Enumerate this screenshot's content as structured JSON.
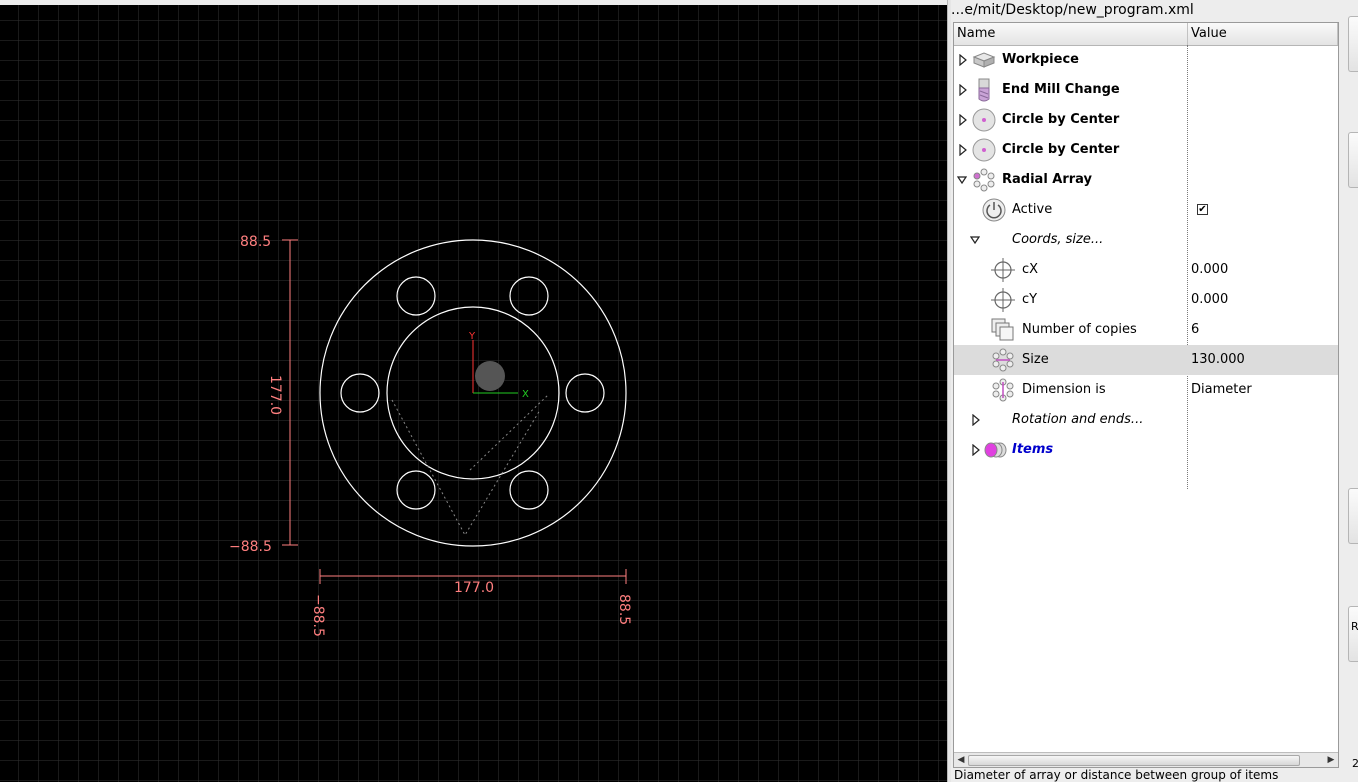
{
  "window": {
    "file_path": "...e/mit/Desktop/new_program.xml"
  },
  "tree": {
    "columns": {
      "name": "Name",
      "value": "Value"
    },
    "rows": [
      {
        "label": "Workpiece",
        "value": ""
      },
      {
        "label": "End Mill Change",
        "value": ""
      },
      {
        "label": "Circle by Center",
        "value": ""
      },
      {
        "label": "Circle by Center",
        "value": ""
      },
      {
        "label": "Radial Array",
        "value": ""
      },
      {
        "label": "Active",
        "value": ""
      },
      {
        "label": "Coords, size...",
        "value": ""
      },
      {
        "label": "cX",
        "value": "0.000"
      },
      {
        "label": "cY",
        "value": "0.000"
      },
      {
        "label": "Number of copies",
        "value": "6"
      },
      {
        "label": "Size",
        "value": "130.000"
      },
      {
        "label": "Dimension is",
        "value": "Diameter"
      },
      {
        "label": "Rotation and ends...",
        "value": ""
      },
      {
        "label": "Items",
        "value": ""
      }
    ],
    "active_checked": true,
    "checkbox_mark": "✔"
  },
  "canvas": {
    "axis_x_label": "X",
    "axis_y_label": "Y",
    "dim_vertical_top": "88.5",
    "dim_vertical_bottom": "−88.5",
    "dim_vertical_length": "177.0",
    "dim_horizontal_left": "−88.5",
    "dim_horizontal_right": "88.5",
    "dim_horizontal_length": "177.0",
    "colors": {
      "background": "#000000",
      "grid": "#333333",
      "geometry": "#ffffff",
      "dimension": "#ff7f7f",
      "axis_x": "#22cc22",
      "axis_y": "#ff3333"
    }
  },
  "edge": {
    "button_letter": "R",
    "corner_digit": "2"
  },
  "status": {
    "text": "Diameter of array or distance between group of items"
  }
}
